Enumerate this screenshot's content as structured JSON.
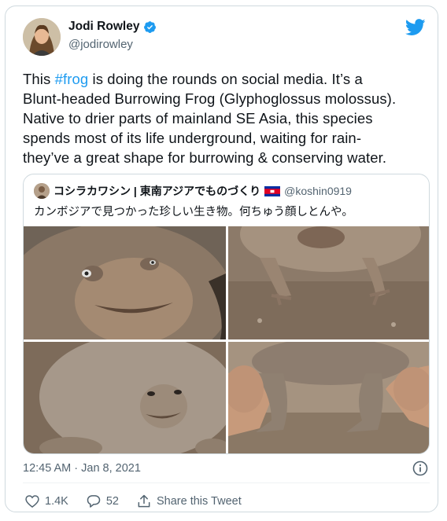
{
  "author": {
    "display_name": "Jodi Rowley",
    "handle": "@jodirowley"
  },
  "tweet": {
    "lines": [
      [
        "This ",
        "#frog",
        " is doing the rounds on social media. It’s a"
      ],
      "Blunt-headed Burrowing Frog (Glyphoglossus molossus).",
      "Native to drier parts of mainland SE Asia, this species",
      "spends most of its life underground, waiting for rain-",
      "they’ve a great shape for burrowing & conserving water."
    ]
  },
  "quoted": {
    "display_name": "コシラカワシン | 東南アジアでものづくり",
    "handle": "@koshin0919",
    "text": "カンボジアで見つかった珍しい生き物。何ちゅう顔しとんや。"
  },
  "meta": {
    "timestamp": "12:45 AM · Jan 8, 2021"
  },
  "actions": {
    "likes": "1.4K",
    "replies": "52",
    "share_label": "Share this Tweet"
  },
  "icons": {
    "verified": "verified-badge-icon",
    "brand": "twitter-bird-icon",
    "info": "info-icon",
    "like": "heart-icon",
    "reply": "reply-bubble-icon",
    "share": "share-icon"
  },
  "colors": {
    "accent": "#1d9bf0",
    "text": "#0f1419",
    "muted": "#536471",
    "border": "#cfd9de"
  }
}
